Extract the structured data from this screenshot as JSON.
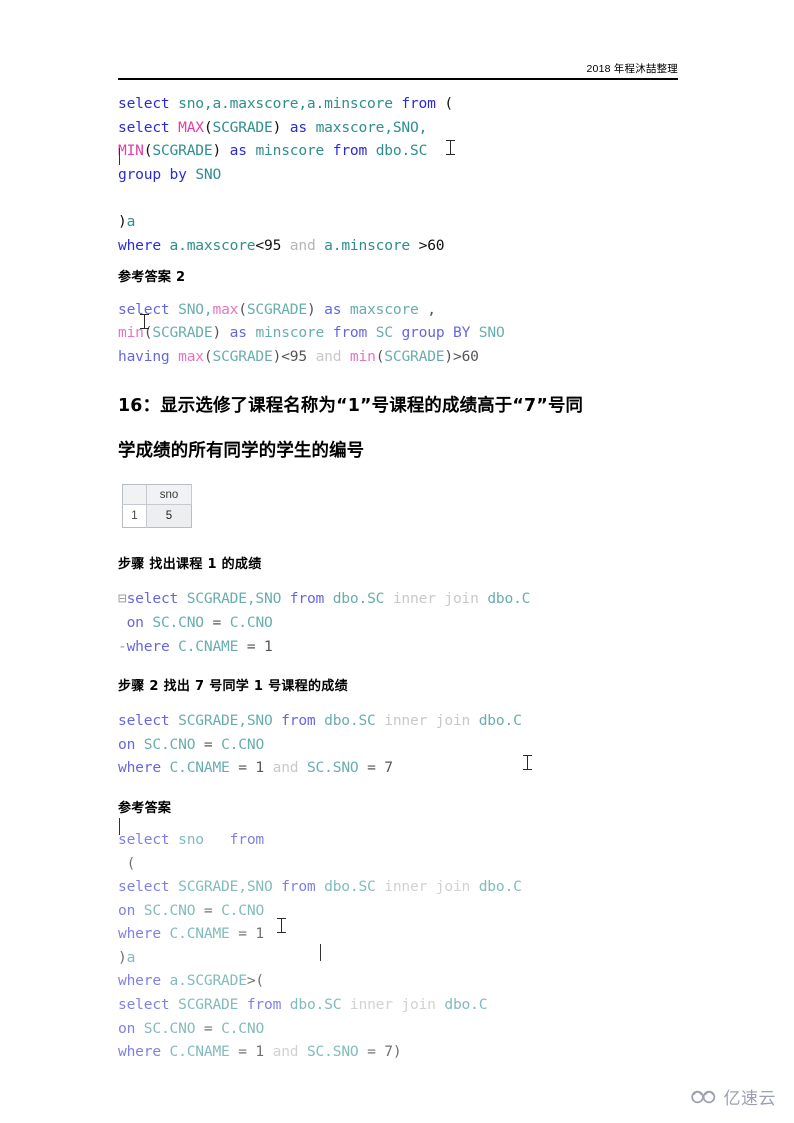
{
  "header": {
    "text": "2018 年程沐喆整理"
  },
  "colors": {
    "keyword": "#2b2bd8",
    "identifier": "#2f8e8e",
    "function": "#e040a8",
    "dim": "#b4b4b4",
    "literal": "#111111",
    "rule": "#000000",
    "grid_header_bg": "#f1f2f4",
    "selected_cell_bg": "#eceef0",
    "watermark": "#8a90a6"
  },
  "blocks": {
    "code1": {
      "lines": [
        [
          {
            "t": "select",
            "c": "kw"
          },
          {
            "t": " ",
            "c": "plain"
          },
          {
            "t": "sno,a.maxscore,a.minscore",
            "c": "id"
          },
          {
            "t": " ",
            "c": "plain"
          },
          {
            "t": "from",
            "c": "kw"
          },
          {
            "t": " ",
            "c": "plain"
          },
          {
            "t": "(",
            "c": "op"
          }
        ],
        [
          {
            "t": "select",
            "c": "kw"
          },
          {
            "t": " ",
            "c": "plain"
          },
          {
            "t": "MAX",
            "c": "fn"
          },
          {
            "t": "(",
            "c": "op"
          },
          {
            "t": "SCGRADE",
            "c": "id"
          },
          {
            "t": ")",
            "c": "op"
          },
          {
            "t": " ",
            "c": "plain"
          },
          {
            "t": "as",
            "c": "kw"
          },
          {
            "t": " ",
            "c": "plain"
          },
          {
            "t": "maxscore,SNO,",
            "c": "id"
          }
        ],
        [
          {
            "t": "MIN",
            "c": "fn"
          },
          {
            "t": "(",
            "c": "op"
          },
          {
            "t": "SCGRADE",
            "c": "id"
          },
          {
            "t": ")",
            "c": "op"
          },
          {
            "t": " ",
            "c": "plain"
          },
          {
            "t": "as",
            "c": "kw"
          },
          {
            "t": " ",
            "c": "plain"
          },
          {
            "t": "minscore",
            "c": "id"
          },
          {
            "t": " ",
            "c": "plain"
          },
          {
            "t": "from",
            "c": "kw"
          },
          {
            "t": " ",
            "c": "plain"
          },
          {
            "t": "dbo.SC",
            "c": "id"
          }
        ],
        [
          {
            "t": "group",
            "c": "kw"
          },
          {
            "t": " ",
            "c": "plain"
          },
          {
            "t": "by",
            "c": "kw"
          },
          {
            "t": " ",
            "c": "plain"
          },
          {
            "t": "SNO",
            "c": "id"
          }
        ]
      ]
    },
    "code2": {
      "lines": [
        [
          {
            "t": ")",
            "c": "op"
          },
          {
            "t": "a",
            "c": "id"
          }
        ],
        [
          {
            "t": "where",
            "c": "kw"
          },
          {
            "t": " ",
            "c": "plain"
          },
          {
            "t": "a.maxscore",
            "c": "id"
          },
          {
            "t": "<",
            "c": "op"
          },
          {
            "t": "95",
            "c": "num"
          },
          {
            "t": " ",
            "c": "plain"
          },
          {
            "t": "and",
            "c": "dim"
          },
          {
            "t": " ",
            "c": "plain"
          },
          {
            "t": "a.minscore",
            "c": "id"
          },
          {
            "t": " ",
            "c": "plain"
          },
          {
            "t": ">",
            "c": "op"
          },
          {
            "t": "60",
            "c": "num"
          }
        ]
      ]
    },
    "heading_answer2": "参考答案 2",
    "code3": {
      "lines": [
        [
          {
            "t": "select",
            "c": "kw"
          },
          {
            "t": " ",
            "c": "plain"
          },
          {
            "t": "SNO,",
            "c": "id"
          },
          {
            "t": "max",
            "c": "fn"
          },
          {
            "t": "(",
            "c": "op"
          },
          {
            "t": "SCGRADE",
            "c": "id"
          },
          {
            "t": ")",
            "c": "op"
          },
          {
            "t": " ",
            "c": "plain"
          },
          {
            "t": "as",
            "c": "kw"
          },
          {
            "t": " ",
            "c": "plain"
          },
          {
            "t": "maxscore",
            "c": "id"
          },
          {
            "t": " ",
            "c": "plain"
          },
          {
            "t": ",",
            "c": "op"
          }
        ],
        [
          {
            "t": "min",
            "c": "fn"
          },
          {
            "t": "(",
            "c": "op"
          },
          {
            "t": "SCGRADE",
            "c": "id"
          },
          {
            "t": ")",
            "c": "op"
          },
          {
            "t": " ",
            "c": "plain"
          },
          {
            "t": "as",
            "c": "kw"
          },
          {
            "t": " ",
            "c": "plain"
          },
          {
            "t": "minscore",
            "c": "id"
          },
          {
            "t": " ",
            "c": "plain"
          },
          {
            "t": "from",
            "c": "kw"
          },
          {
            "t": " ",
            "c": "plain"
          },
          {
            "t": "SC",
            "c": "id"
          },
          {
            "t": " ",
            "c": "plain"
          },
          {
            "t": "group",
            "c": "kw"
          },
          {
            "t": " ",
            "c": "plain"
          },
          {
            "t": "BY",
            "c": "kw"
          },
          {
            "t": " ",
            "c": "plain"
          },
          {
            "t": "SNO",
            "c": "id"
          }
        ],
        [
          {
            "t": "having",
            "c": "kw"
          },
          {
            "t": " ",
            "c": "plain"
          },
          {
            "t": "max",
            "c": "fn"
          },
          {
            "t": "(",
            "c": "op"
          },
          {
            "t": "SCGRADE",
            "c": "id"
          },
          {
            "t": ")",
            "c": "op"
          },
          {
            "t": "<",
            "c": "op"
          },
          {
            "t": "95",
            "c": "num"
          },
          {
            "t": " ",
            "c": "plain"
          },
          {
            "t": "and",
            "c": "dim"
          },
          {
            "t": " ",
            "c": "plain"
          },
          {
            "t": "min",
            "c": "fn"
          },
          {
            "t": "(",
            "c": "op"
          },
          {
            "t": "SCGRADE",
            "c": "id"
          },
          {
            "t": ")",
            "c": "op"
          },
          {
            "t": ">",
            "c": "op"
          },
          {
            "t": "60",
            "c": "num"
          }
        ]
      ]
    },
    "question16": {
      "line1": "16：显示选修了课程名称为“1”号课程的成绩高于“7”号同",
      "line2": "学成绩的所有同学的学生的编号"
    },
    "result_grid": {
      "column_header": "sno",
      "row_number": "1",
      "value": "5"
    },
    "heading_step1": "步骤 找出课程 1 的成绩",
    "code4": {
      "lines": [
        [
          {
            "t": "⊟",
            "c": "gut"
          },
          {
            "t": "select",
            "c": "kw"
          },
          {
            "t": " ",
            "c": "plain"
          },
          {
            "t": "SCGRADE,SNO",
            "c": "id"
          },
          {
            "t": " ",
            "c": "plain"
          },
          {
            "t": "from",
            "c": "kw"
          },
          {
            "t": " ",
            "c": "plain"
          },
          {
            "t": "dbo.SC",
            "c": "id"
          },
          {
            "t": " ",
            "c": "plain"
          },
          {
            "t": "inner join",
            "c": "dim"
          },
          {
            "t": " ",
            "c": "plain"
          },
          {
            "t": "dbo.C",
            "c": "id"
          }
        ],
        [
          {
            "t": " ",
            "c": "plain"
          },
          {
            "t": "on",
            "c": "kw"
          },
          {
            "t": " ",
            "c": "plain"
          },
          {
            "t": "SC.CNO",
            "c": "id"
          },
          {
            "t": " ",
            "c": "plain"
          },
          {
            "t": "=",
            "c": "op"
          },
          {
            "t": " ",
            "c": "plain"
          },
          {
            "t": "C.CNO",
            "c": "id"
          }
        ],
        [
          {
            "t": "-",
            "c": "gut"
          },
          {
            "t": "where",
            "c": "kw"
          },
          {
            "t": " ",
            "c": "plain"
          },
          {
            "t": "C.CNAME",
            "c": "id"
          },
          {
            "t": " ",
            "c": "plain"
          },
          {
            "t": "=",
            "c": "op"
          },
          {
            "t": " ",
            "c": "plain"
          },
          {
            "t": "1",
            "c": "num"
          }
        ]
      ]
    },
    "heading_step2": "步骤 2 找出 7 号同学 1 号课程的成绩",
    "code5": {
      "lines": [
        [
          {
            "t": "select",
            "c": "kw"
          },
          {
            "t": " ",
            "c": "plain"
          },
          {
            "t": "SCGRADE,SNO",
            "c": "id"
          },
          {
            "t": " ",
            "c": "plain"
          },
          {
            "t": "from",
            "c": "kw"
          },
          {
            "t": " ",
            "c": "plain"
          },
          {
            "t": "dbo.SC",
            "c": "id"
          },
          {
            "t": " ",
            "c": "plain"
          },
          {
            "t": "inner join",
            "c": "dim"
          },
          {
            "t": " ",
            "c": "plain"
          },
          {
            "t": "dbo.C",
            "c": "id"
          }
        ],
        [
          {
            "t": "on",
            "c": "kw"
          },
          {
            "t": " ",
            "c": "plain"
          },
          {
            "t": "SC.CNO",
            "c": "id"
          },
          {
            "t": " ",
            "c": "plain"
          },
          {
            "t": "=",
            "c": "op"
          },
          {
            "t": " ",
            "c": "plain"
          },
          {
            "t": "C.CNO",
            "c": "id"
          }
        ],
        [
          {
            "t": "where",
            "c": "kw"
          },
          {
            "t": " ",
            "c": "plain"
          },
          {
            "t": "C.CNAME",
            "c": "id"
          },
          {
            "t": " ",
            "c": "plain"
          },
          {
            "t": "=",
            "c": "op"
          },
          {
            "t": " ",
            "c": "plain"
          },
          {
            "t": "1",
            "c": "num"
          },
          {
            "t": " ",
            "c": "plain"
          },
          {
            "t": "and",
            "c": "dim"
          },
          {
            "t": " ",
            "c": "plain"
          },
          {
            "t": "SC.SNO",
            "c": "id"
          },
          {
            "t": " ",
            "c": "plain"
          },
          {
            "t": "=",
            "c": "op"
          },
          {
            "t": " ",
            "c": "plain"
          },
          {
            "t": "7",
            "c": "num"
          }
        ]
      ]
    },
    "heading_answer": "参考答案",
    "code6": {
      "lines": [
        [
          {
            "t": "select",
            "c": "kw"
          },
          {
            "t": " ",
            "c": "plain"
          },
          {
            "t": "sno",
            "c": "id"
          },
          {
            "t": "   ",
            "c": "plain"
          },
          {
            "t": "from",
            "c": "kw"
          }
        ],
        [
          {
            "t": " ",
            "c": "plain"
          },
          {
            "t": "(",
            "c": "op"
          }
        ],
        [
          {
            "t": "select",
            "c": "kw"
          },
          {
            "t": " ",
            "c": "plain"
          },
          {
            "t": "SCGRADE,SNO",
            "c": "id"
          },
          {
            "t": " ",
            "c": "plain"
          },
          {
            "t": "from",
            "c": "kw"
          },
          {
            "t": " ",
            "c": "plain"
          },
          {
            "t": "dbo.SC",
            "c": "id"
          },
          {
            "t": " ",
            "c": "plain"
          },
          {
            "t": "inner join",
            "c": "dim"
          },
          {
            "t": " ",
            "c": "plain"
          },
          {
            "t": "dbo.C",
            "c": "id"
          }
        ],
        [
          {
            "t": "on",
            "c": "kw"
          },
          {
            "t": " ",
            "c": "plain"
          },
          {
            "t": "SC.CNO",
            "c": "id"
          },
          {
            "t": " ",
            "c": "plain"
          },
          {
            "t": "=",
            "c": "op"
          },
          {
            "t": " ",
            "c": "plain"
          },
          {
            "t": "C.CNO",
            "c": "id"
          }
        ],
        [
          {
            "t": "where",
            "c": "kw"
          },
          {
            "t": " ",
            "c": "plain"
          },
          {
            "t": "C.CNAME",
            "c": "id"
          },
          {
            "t": " ",
            "c": "plain"
          },
          {
            "t": "=",
            "c": "op"
          },
          {
            "t": " ",
            "c": "plain"
          },
          {
            "t": "1",
            "c": "num"
          }
        ],
        [
          {
            "t": ")",
            "c": "op"
          },
          {
            "t": "a",
            "c": "id"
          }
        ],
        [
          {
            "t": "where",
            "c": "kw"
          },
          {
            "t": " ",
            "c": "plain"
          },
          {
            "t": "a.SCGRADE",
            "c": "id"
          },
          {
            "t": ">",
            "c": "op"
          },
          {
            "t": "(",
            "c": "op"
          }
        ],
        [
          {
            "t": "select",
            "c": "kw"
          },
          {
            "t": " ",
            "c": "plain"
          },
          {
            "t": "SCGRADE",
            "c": "id"
          },
          {
            "t": " ",
            "c": "plain"
          },
          {
            "t": "from",
            "c": "kw"
          },
          {
            "t": " ",
            "c": "plain"
          },
          {
            "t": "dbo.SC",
            "c": "id"
          },
          {
            "t": " ",
            "c": "plain"
          },
          {
            "t": "inner join",
            "c": "dim"
          },
          {
            "t": " ",
            "c": "plain"
          },
          {
            "t": "dbo.C",
            "c": "id"
          }
        ],
        [
          {
            "t": "on",
            "c": "kw"
          },
          {
            "t": " ",
            "c": "plain"
          },
          {
            "t": "SC.CNO",
            "c": "id"
          },
          {
            "t": " ",
            "c": "plain"
          },
          {
            "t": "=",
            "c": "op"
          },
          {
            "t": " ",
            "c": "plain"
          },
          {
            "t": "C.CNO",
            "c": "id"
          }
        ],
        [
          {
            "t": "where",
            "c": "kw"
          },
          {
            "t": " ",
            "c": "plain"
          },
          {
            "t": "C.CNAME",
            "c": "id"
          },
          {
            "t": " ",
            "c": "plain"
          },
          {
            "t": "=",
            "c": "op"
          },
          {
            "t": " ",
            "c": "plain"
          },
          {
            "t": "1",
            "c": "num"
          },
          {
            "t": " ",
            "c": "plain"
          },
          {
            "t": "and",
            "c": "dim"
          },
          {
            "t": " ",
            "c": "plain"
          },
          {
            "t": "SC.SNO",
            "c": "id"
          },
          {
            "t": " ",
            "c": "plain"
          },
          {
            "t": "=",
            "c": "op"
          },
          {
            "t": " ",
            "c": "plain"
          },
          {
            "t": "7",
            "c": "num"
          },
          {
            "t": ")",
            "c": "op"
          }
        ]
      ]
    }
  },
  "watermark": {
    "text": "亿速云"
  }
}
